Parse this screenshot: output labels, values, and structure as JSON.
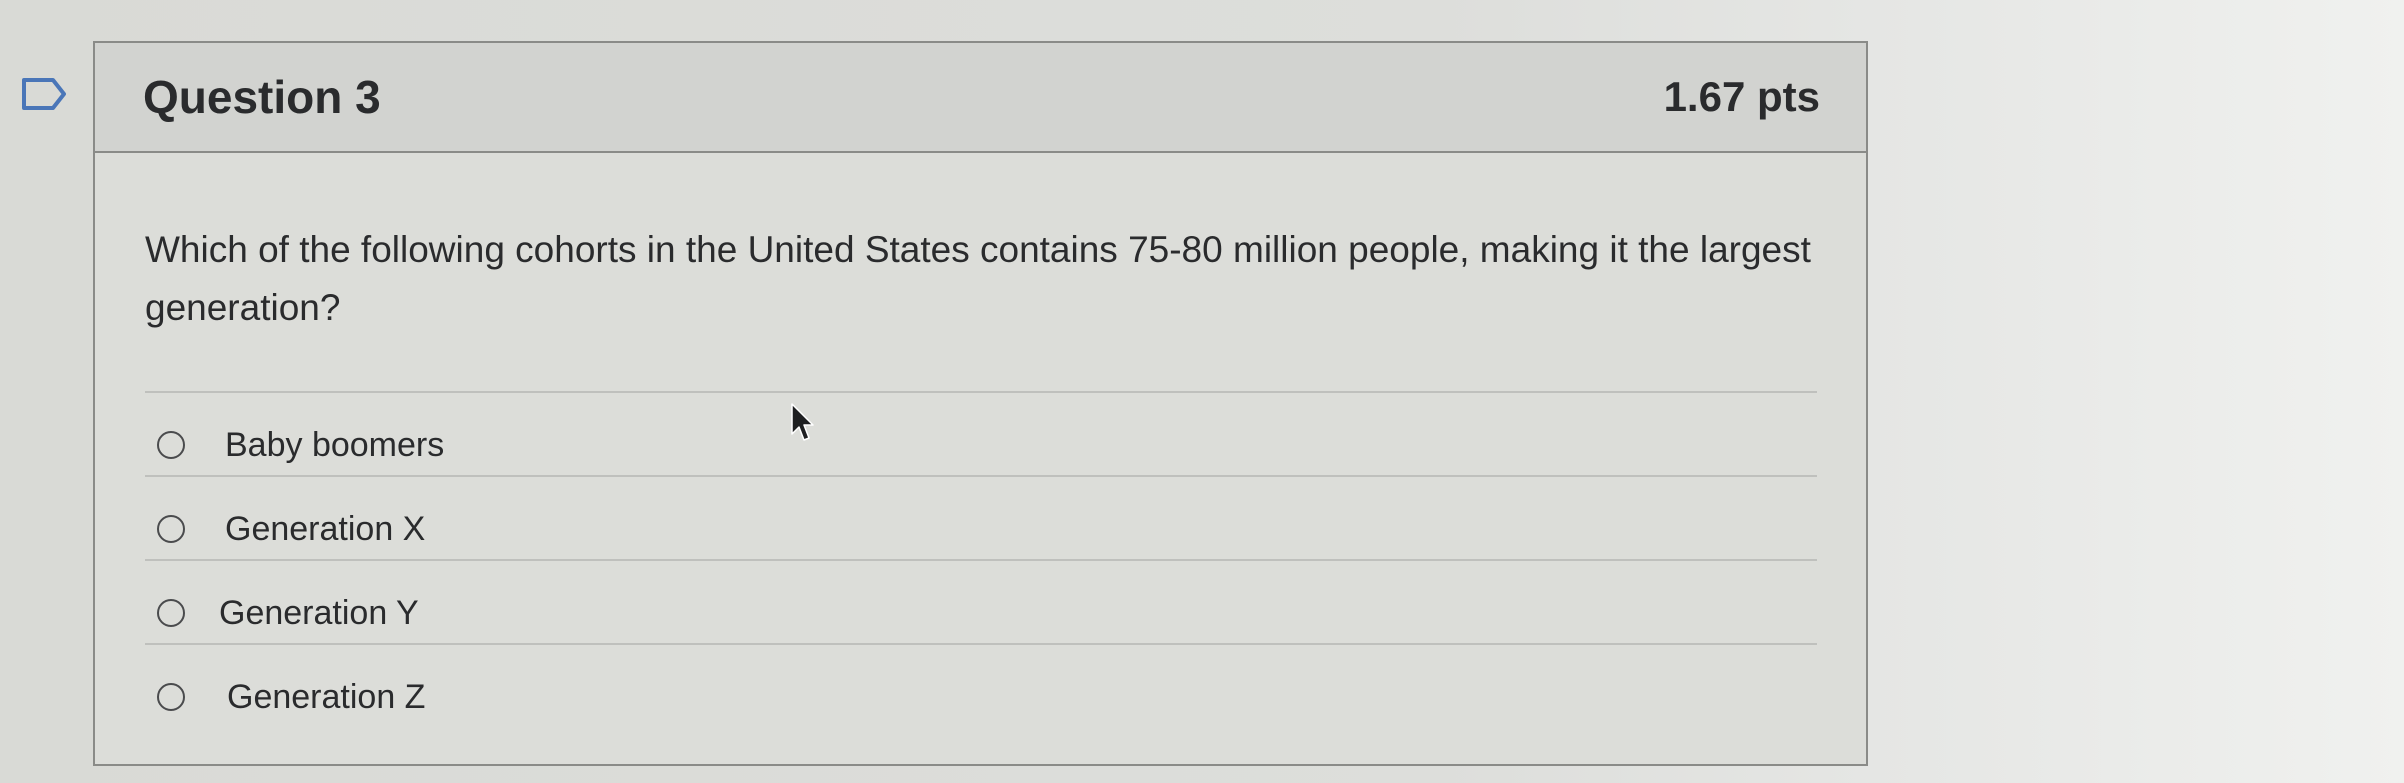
{
  "question": {
    "title": "Question 3",
    "points": "1.67 pts",
    "text": "Which of the following cohorts in the United States contains 75-80 million people, making it the largest generation?"
  },
  "answers": [
    {
      "label": "Baby boomers",
      "selected": false
    },
    {
      "label": "Generation X",
      "selected": false
    },
    {
      "label": "Generation Y",
      "selected": false
    },
    {
      "label": "Generation Z",
      "selected": false
    }
  ],
  "icons": {
    "flag": "bookmark-flag-icon",
    "cursor": "mouse-pointer-icon"
  }
}
